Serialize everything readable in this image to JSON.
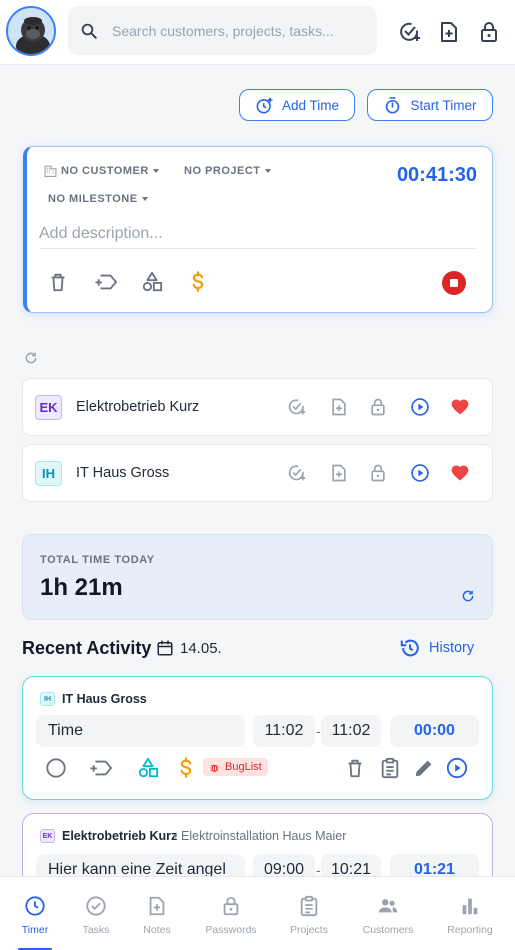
{
  "header": {
    "search_placeholder": "Search customers, projects, tasks...",
    "icons": [
      "gorilla-avatar",
      "search-icon",
      "task-add-icon",
      "note-add-icon",
      "lock-icon"
    ]
  },
  "actions": {
    "add_time": "Add Time",
    "start_timer": "Start Timer"
  },
  "timer": {
    "customer": "NO CUSTOMER",
    "project": "NO PROJECT",
    "milestone": "NO MILESTONE",
    "elapsed": "00:41:30",
    "description_placeholder": "Add description..."
  },
  "favorites": [
    {
      "initials": "EK",
      "name": "Elektrobetrieb Kurz",
      "badge_bg": "#ede9fe",
      "badge_fg": "#6d28d9"
    },
    {
      "initials": "IH",
      "name": "IT Haus Gross",
      "badge_bg": "#e0f7fa",
      "badge_fg": "#0891b2"
    }
  ],
  "total": {
    "label": "TOTAL TIME TODAY",
    "value": "1h 21m"
  },
  "recent": {
    "title": "Recent Activity",
    "date": "14.05.",
    "history": "History",
    "entries": [
      {
        "initials": "IH",
        "customer": "IT Haus Gross",
        "project": "",
        "description": "Time",
        "start": "11:02",
        "end": "11:02",
        "duration": "00:00",
        "tag": "BugList"
      },
      {
        "initials": "EK",
        "customer": "Elektrobetrieb Kurz",
        "project": "Elektroinstallation Haus Maier",
        "description": "Hier kann eine Zeit angel",
        "start": "09:00",
        "end": "10:21",
        "duration": "01:21"
      }
    ]
  },
  "nav": [
    {
      "label": "Timer",
      "active": true
    },
    {
      "label": "Tasks"
    },
    {
      "label": "Notes"
    },
    {
      "label": "Passwords"
    },
    {
      "label": "Projects"
    },
    {
      "label": "Customers"
    },
    {
      "label": "Reporting"
    }
  ],
  "colors": {
    "accent": "#3b82f6",
    "danger": "#dc2626",
    "heart": "#ef4444",
    "amber": "#f59e0b",
    "teal": "#06b6d4"
  }
}
